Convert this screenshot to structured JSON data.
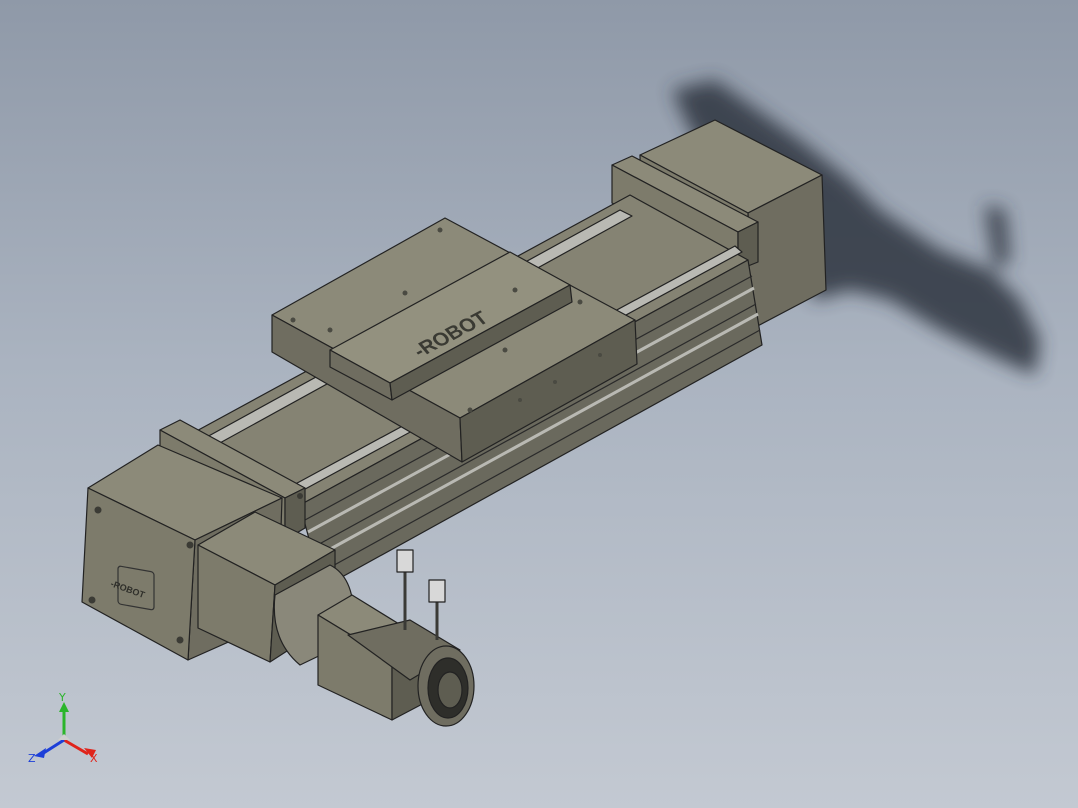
{
  "model": {
    "brand_logo_text": "-ROBOT",
    "end_plate_logo_text": "-ROBOT",
    "colors": {
      "body": "#7d7b6b",
      "body_light": "#8c8a79",
      "body_dark": "#5e5d51",
      "edge": "#222222",
      "rail": "#b9b9b3",
      "shadow": "#2f3540"
    }
  },
  "triad": {
    "x_label": "X",
    "y_label": "Y",
    "z_label": "Z",
    "x_color": "#e0241b",
    "y_color": "#2bb52b",
    "z_color": "#1d3fd8"
  }
}
